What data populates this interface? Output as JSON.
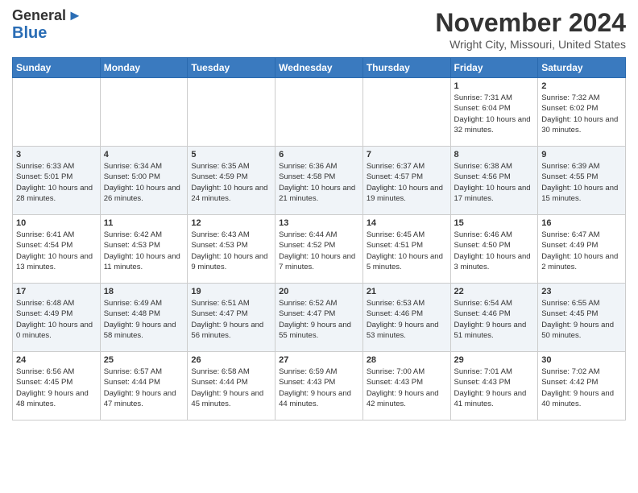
{
  "header": {
    "logo_line1": "General",
    "logo_line2": "Blue",
    "month": "November 2024",
    "location": "Wright City, Missouri, United States"
  },
  "weekdays": [
    "Sunday",
    "Monday",
    "Tuesday",
    "Wednesday",
    "Thursday",
    "Friday",
    "Saturday"
  ],
  "weeks": [
    [
      {
        "day": "",
        "info": ""
      },
      {
        "day": "",
        "info": ""
      },
      {
        "day": "",
        "info": ""
      },
      {
        "day": "",
        "info": ""
      },
      {
        "day": "",
        "info": ""
      },
      {
        "day": "1",
        "info": "Sunrise: 7:31 AM\nSunset: 6:04 PM\nDaylight: 10 hours and 32 minutes."
      },
      {
        "day": "2",
        "info": "Sunrise: 7:32 AM\nSunset: 6:02 PM\nDaylight: 10 hours and 30 minutes."
      }
    ],
    [
      {
        "day": "3",
        "info": "Sunrise: 6:33 AM\nSunset: 5:01 PM\nDaylight: 10 hours and 28 minutes."
      },
      {
        "day": "4",
        "info": "Sunrise: 6:34 AM\nSunset: 5:00 PM\nDaylight: 10 hours and 26 minutes."
      },
      {
        "day": "5",
        "info": "Sunrise: 6:35 AM\nSunset: 4:59 PM\nDaylight: 10 hours and 24 minutes."
      },
      {
        "day": "6",
        "info": "Sunrise: 6:36 AM\nSunset: 4:58 PM\nDaylight: 10 hours and 21 minutes."
      },
      {
        "day": "7",
        "info": "Sunrise: 6:37 AM\nSunset: 4:57 PM\nDaylight: 10 hours and 19 minutes."
      },
      {
        "day": "8",
        "info": "Sunrise: 6:38 AM\nSunset: 4:56 PM\nDaylight: 10 hours and 17 minutes."
      },
      {
        "day": "9",
        "info": "Sunrise: 6:39 AM\nSunset: 4:55 PM\nDaylight: 10 hours and 15 minutes."
      }
    ],
    [
      {
        "day": "10",
        "info": "Sunrise: 6:41 AM\nSunset: 4:54 PM\nDaylight: 10 hours and 13 minutes."
      },
      {
        "day": "11",
        "info": "Sunrise: 6:42 AM\nSunset: 4:53 PM\nDaylight: 10 hours and 11 minutes."
      },
      {
        "day": "12",
        "info": "Sunrise: 6:43 AM\nSunset: 4:53 PM\nDaylight: 10 hours and 9 minutes."
      },
      {
        "day": "13",
        "info": "Sunrise: 6:44 AM\nSunset: 4:52 PM\nDaylight: 10 hours and 7 minutes."
      },
      {
        "day": "14",
        "info": "Sunrise: 6:45 AM\nSunset: 4:51 PM\nDaylight: 10 hours and 5 minutes."
      },
      {
        "day": "15",
        "info": "Sunrise: 6:46 AM\nSunset: 4:50 PM\nDaylight: 10 hours and 3 minutes."
      },
      {
        "day": "16",
        "info": "Sunrise: 6:47 AM\nSunset: 4:49 PM\nDaylight: 10 hours and 2 minutes."
      }
    ],
    [
      {
        "day": "17",
        "info": "Sunrise: 6:48 AM\nSunset: 4:49 PM\nDaylight: 10 hours and 0 minutes."
      },
      {
        "day": "18",
        "info": "Sunrise: 6:49 AM\nSunset: 4:48 PM\nDaylight: 9 hours and 58 minutes."
      },
      {
        "day": "19",
        "info": "Sunrise: 6:51 AM\nSunset: 4:47 PM\nDaylight: 9 hours and 56 minutes."
      },
      {
        "day": "20",
        "info": "Sunrise: 6:52 AM\nSunset: 4:47 PM\nDaylight: 9 hours and 55 minutes."
      },
      {
        "day": "21",
        "info": "Sunrise: 6:53 AM\nSunset: 4:46 PM\nDaylight: 9 hours and 53 minutes."
      },
      {
        "day": "22",
        "info": "Sunrise: 6:54 AM\nSunset: 4:46 PM\nDaylight: 9 hours and 51 minutes."
      },
      {
        "day": "23",
        "info": "Sunrise: 6:55 AM\nSunset: 4:45 PM\nDaylight: 9 hours and 50 minutes."
      }
    ],
    [
      {
        "day": "24",
        "info": "Sunrise: 6:56 AM\nSunset: 4:45 PM\nDaylight: 9 hours and 48 minutes."
      },
      {
        "day": "25",
        "info": "Sunrise: 6:57 AM\nSunset: 4:44 PM\nDaylight: 9 hours and 47 minutes."
      },
      {
        "day": "26",
        "info": "Sunrise: 6:58 AM\nSunset: 4:44 PM\nDaylight: 9 hours and 45 minutes."
      },
      {
        "day": "27",
        "info": "Sunrise: 6:59 AM\nSunset: 4:43 PM\nDaylight: 9 hours and 44 minutes."
      },
      {
        "day": "28",
        "info": "Sunrise: 7:00 AM\nSunset: 4:43 PM\nDaylight: 9 hours and 42 minutes."
      },
      {
        "day": "29",
        "info": "Sunrise: 7:01 AM\nSunset: 4:43 PM\nDaylight: 9 hours and 41 minutes."
      },
      {
        "day": "30",
        "info": "Sunrise: 7:02 AM\nSunset: 4:42 PM\nDaylight: 9 hours and 40 minutes."
      }
    ]
  ]
}
